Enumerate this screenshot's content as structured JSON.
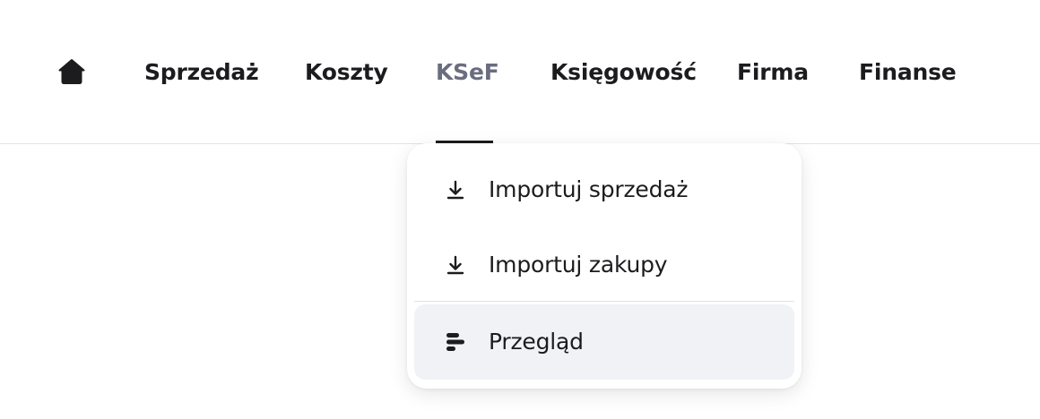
{
  "nav": {
    "home_icon": "home-icon",
    "items": [
      {
        "label": "Sprzedaż",
        "active": false
      },
      {
        "label": "Koszty",
        "active": false
      },
      {
        "label": "KSeF",
        "active": true
      },
      {
        "label": "Księgowość",
        "active": false
      },
      {
        "label": "Firma",
        "active": false
      },
      {
        "label": "Finanse",
        "active": false
      }
    ]
  },
  "dropdown": {
    "items": [
      {
        "label": "Importuj sprzedaż",
        "icon": "download-icon",
        "highlighted": false
      },
      {
        "label": "Importuj zakupy",
        "icon": "download-icon",
        "highlighted": false
      },
      {
        "label": "Przegląd",
        "icon": "overview-bars-icon",
        "highlighted": true
      }
    ]
  },
  "colors": {
    "text": "#1c1c1f",
    "active_text": "#6a6d7e",
    "highlight_bg": "#f1f2f6",
    "divider": "#e3e3e6"
  }
}
